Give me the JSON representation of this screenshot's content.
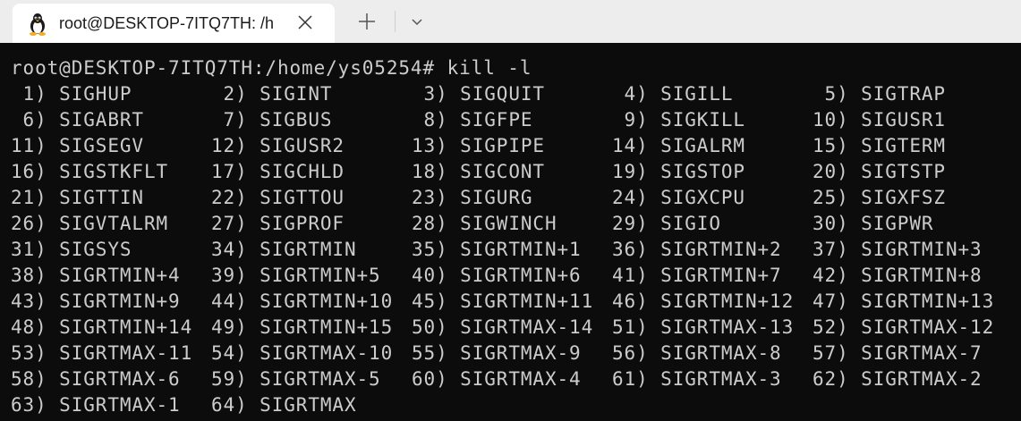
{
  "tab": {
    "title": "root@DESKTOP-7ITQ7TH: /h",
    "icon": "linux-penguin-icon"
  },
  "tabbar": {
    "new_tab_icon": "plus-icon",
    "dropdown_icon": "chevron-down-icon"
  },
  "terminal": {
    "prompt": "root@DESKTOP-7ITQ7TH:/home/ys05254#",
    "command": "kill -l",
    "rows": [
      [
        " 1) SIGHUP",
        " 2) SIGINT",
        " 3) SIGQUIT",
        " 4) SIGILL",
        " 5) SIGTRAP"
      ],
      [
        " 6) SIGABRT",
        " 7) SIGBUS",
        " 8) SIGFPE",
        " 9) SIGKILL",
        "10) SIGUSR1"
      ],
      [
        "11) SIGSEGV",
        "12) SIGUSR2",
        "13) SIGPIPE",
        "14) SIGALRM",
        "15) SIGTERM"
      ],
      [
        "16) SIGSTKFLT",
        "17) SIGCHLD",
        "18) SIGCONT",
        "19) SIGSTOP",
        "20) SIGTSTP"
      ],
      [
        "21) SIGTTIN",
        "22) SIGTTOU",
        "23) SIGURG",
        "24) SIGXCPU",
        "25) SIGXFSZ"
      ],
      [
        "26) SIGVTALRM",
        "27) SIGPROF",
        "28) SIGWINCH",
        "29) SIGIO",
        "30) SIGPWR"
      ],
      [
        "31) SIGSYS",
        "34) SIGRTMIN",
        "35) SIGRTMIN+1",
        "36) SIGRTMIN+2",
        "37) SIGRTMIN+3"
      ],
      [
        "38) SIGRTMIN+4",
        "39) SIGRTMIN+5",
        "40) SIGRTMIN+6",
        "41) SIGRTMIN+7",
        "42) SIGRTMIN+8"
      ],
      [
        "43) SIGRTMIN+9",
        "44) SIGRTMIN+10",
        "45) SIGRTMIN+11",
        "46) SIGRTMIN+12",
        "47) SIGRTMIN+13"
      ],
      [
        "48) SIGRTMIN+14",
        "49) SIGRTMIN+15",
        "50) SIGRTMAX-14",
        "51) SIGRTMAX-13",
        "52) SIGRTMAX-12"
      ],
      [
        "53) SIGRTMAX-11",
        "54) SIGRTMAX-10",
        "55) SIGRTMAX-9",
        "56) SIGRTMAX-8",
        "57) SIGRTMAX-7"
      ],
      [
        "58) SIGRTMAX-6",
        "59) SIGRTMAX-5",
        "60) SIGRTMAX-4",
        "61) SIGRTMAX-3",
        "62) SIGRTMAX-2"
      ],
      [
        "63) SIGRTMAX-1",
        "64) SIGRTMAX"
      ]
    ]
  }
}
